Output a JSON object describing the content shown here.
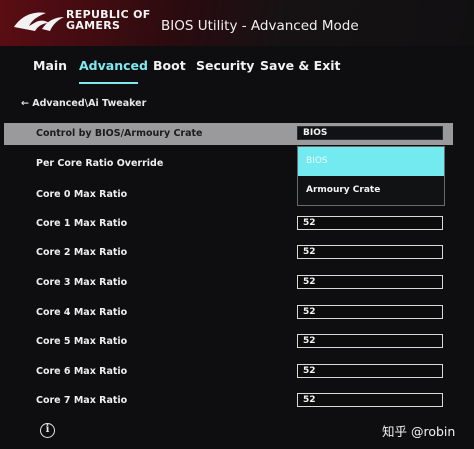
{
  "header": {
    "brand_line1": "REPUBLIC OF",
    "brand_line2": "GAMERS",
    "title": "BIOS Utility - Advanced Mode"
  },
  "tabs": [
    {
      "label": "Main",
      "active": false
    },
    {
      "label": "Advanced",
      "active": true
    },
    {
      "label": "Boot",
      "active": false
    },
    {
      "label": "Security",
      "active": false
    },
    {
      "label": "Save & Exit",
      "active": false
    }
  ],
  "breadcrumb": "← Advanced\\Ai Tweaker",
  "settings": [
    {
      "label": "Control by BIOS/Armoury Crate",
      "value": "BIOS",
      "highlighted": true
    },
    {
      "label": "Per Core Ratio Override",
      "value": ""
    },
    {
      "label": "Core 0 Max Ratio",
      "value": ""
    },
    {
      "label": "Core 1 Max Ratio",
      "value": "52"
    },
    {
      "label": "Core 2 Max Ratio",
      "value": "52"
    },
    {
      "label": "Core 3 Max Ratio",
      "value": "52"
    },
    {
      "label": "Core 4 Max Ratio",
      "value": "52"
    },
    {
      "label": "Core 5 Max Ratio",
      "value": "52"
    },
    {
      "label": "Core 6 Max Ratio",
      "value": "52"
    },
    {
      "label": "Core 7 Max Ratio",
      "value": "52"
    }
  ],
  "dropdown": {
    "options": [
      "BIOS",
      "Armoury Crate"
    ],
    "selected": "BIOS"
  },
  "footer": {
    "info_icon": "info-icon",
    "watermark": "知乎 @robin"
  },
  "colors": {
    "accent": "#7fe9ef",
    "highlight_row": "#9a9a9c",
    "header_red": "#5b0d13"
  }
}
